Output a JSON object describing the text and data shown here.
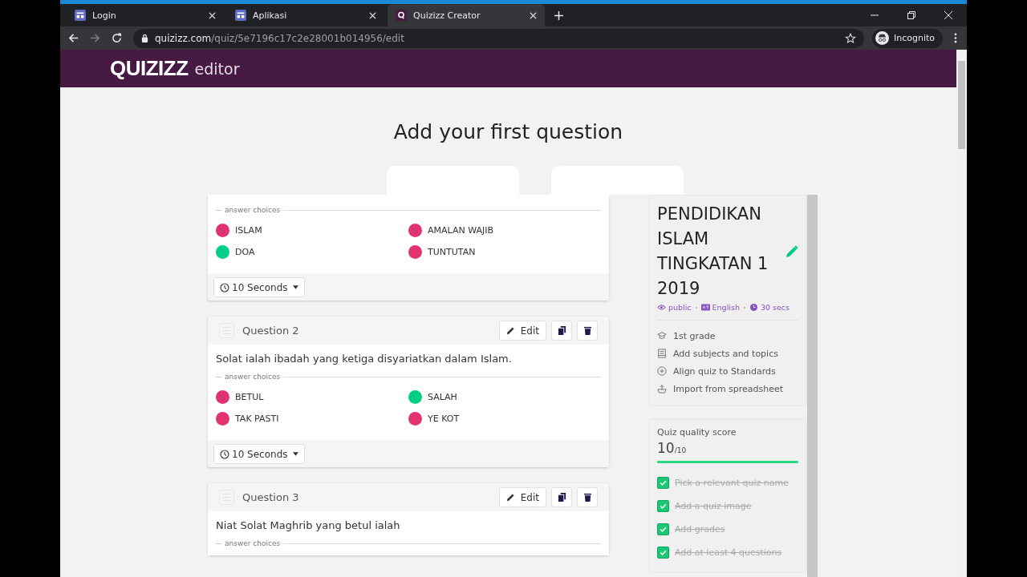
{
  "browser": {
    "tabs": [
      {
        "title": "Login",
        "selected": false
      },
      {
        "title": "Aplikasi",
        "selected": false
      },
      {
        "title": "Quizizz Creator",
        "selected": true
      }
    ],
    "url_host": "quizizz.com",
    "url_path": "/quiz/5e7196c17c2e28001b014956/edit",
    "profile": "Incognito"
  },
  "header": {
    "logo": "QUIZIZZ",
    "subtitle": "editor"
  },
  "heading": "Add your first question",
  "questions": [
    {
      "choices_label": "answer choices",
      "choices": [
        {
          "text": "ISLAM",
          "correct": false
        },
        {
          "text": "AMALAN WAJIB",
          "correct": false
        },
        {
          "text": "DOA",
          "correct": true
        },
        {
          "text": "TUNTUTAN",
          "correct": false
        }
      ],
      "time": "10 Seconds"
    },
    {
      "label": "Question 2",
      "text": "Solat ialah ibadah yang ketiga disyariatkan dalam Islam.",
      "choices_label": "answer choices",
      "choices": [
        {
          "text": "BETUL",
          "correct": false
        },
        {
          "text": "SALAH",
          "correct": true
        },
        {
          "text": "TAK PASTI",
          "correct": false
        },
        {
          "text": "YE KOT",
          "correct": false
        }
      ],
      "time": "10 Seconds",
      "edit": "Edit"
    },
    {
      "label": "Question 3",
      "text": "Niat Solat Maghrib yang betul ialah",
      "choices_label": "answer choices",
      "edit": "Edit"
    }
  ],
  "quiz": {
    "title": "PENDIDIKAN ISLAM TINGKATAN 1 2019",
    "meta": [
      {
        "kind": "visibility",
        "text": "public"
      },
      {
        "kind": "language",
        "text": "English"
      },
      {
        "kind": "time",
        "text": "30 secs"
      }
    ],
    "details": [
      {
        "kind": "grade",
        "text": "1st grade"
      },
      {
        "kind": "subjects",
        "text": "Add subjects and topics"
      },
      {
        "kind": "standards",
        "text": "Align quiz to Standards"
      },
      {
        "kind": "import",
        "text": "Import from spreadsheet"
      }
    ]
  },
  "quality": {
    "label": "Quiz quality score",
    "score": "10",
    "total": "/10",
    "level": 1.0,
    "checklist": [
      {
        "text": "Pick a relevant quiz name",
        "checked": true
      },
      {
        "text": "Add a quiz image",
        "checked": true
      },
      {
        "text": "Add grades",
        "checked": true
      },
      {
        "text": "Add at least 4 questions",
        "checked": true
      }
    ]
  }
}
